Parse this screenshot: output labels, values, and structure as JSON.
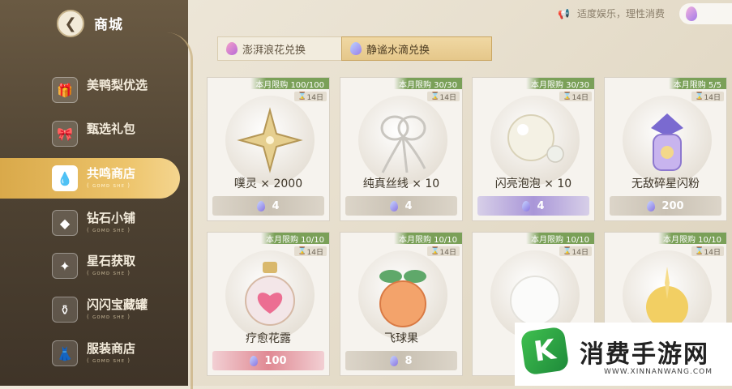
{
  "header": {
    "title": "商城",
    "notice": "适度娱乐，理性消费"
  },
  "sidebar": {
    "items": [
      {
        "label": "美鸭梨优选",
        "sub": ""
      },
      {
        "label": "甄选礼包",
        "sub": ""
      },
      {
        "label": "共鸣商店",
        "sub": "( ɢᴏᴍᴅ ꜱʜᴇ )"
      },
      {
        "label": "钻石小铺",
        "sub": "( ɢᴏᴍᴅ ꜱʜᴇ )"
      },
      {
        "label": "星石获取",
        "sub": "( ɢᴏᴍᴅ ꜱʜᴇ )"
      },
      {
        "label": "闪闪宝藏罐",
        "sub": "( ɢᴏᴍᴅ ꜱʜᴇ )"
      },
      {
        "label": "服装商店",
        "sub": "( ɢᴏᴍᴅ ꜱʜᴇ )"
      }
    ]
  },
  "tabs": [
    {
      "label": "澎湃浪花兑换"
    },
    {
      "label": "静谧水滴兑换"
    }
  ],
  "cards": [
    {
      "limit": "本月限购 100/100",
      "days": "14日",
      "name": "噗灵 × 2000",
      "price": "4",
      "style": "grey"
    },
    {
      "limit": "本月限购 30/30",
      "days": "14日",
      "name": "纯真丝线 × 10",
      "price": "4",
      "style": "grey"
    },
    {
      "limit": "本月限购 30/30",
      "days": "14日",
      "name": "闪亮泡泡 × 10",
      "price": "4",
      "style": "purple"
    },
    {
      "limit": "本月限购 5/5",
      "days": "14日",
      "name": "无敌碎星闪粉",
      "price": "200",
      "style": "grey"
    },
    {
      "limit": "本月限购 10/10",
      "days": "14日",
      "name": "疗愈花露",
      "price": "100",
      "style": "red"
    },
    {
      "limit": "本月限购 10/10",
      "days": "14日",
      "name": "飞球果",
      "price": "8",
      "style": "grey"
    },
    {
      "limit": "本月限购 10/10",
      "days": "14日",
      "name": "",
      "price": "",
      "style": "grey"
    },
    {
      "limit": "本月限购 10/10",
      "days": "14日",
      "name": "",
      "price": "",
      "style": "grey"
    }
  ],
  "watermark": {
    "title": "消费手游网",
    "url": "WWW.XINNANWANG.COM",
    "logo": "K"
  },
  "colors": {
    "accent": "#e6b75c",
    "limit_green": "#7aa058"
  }
}
